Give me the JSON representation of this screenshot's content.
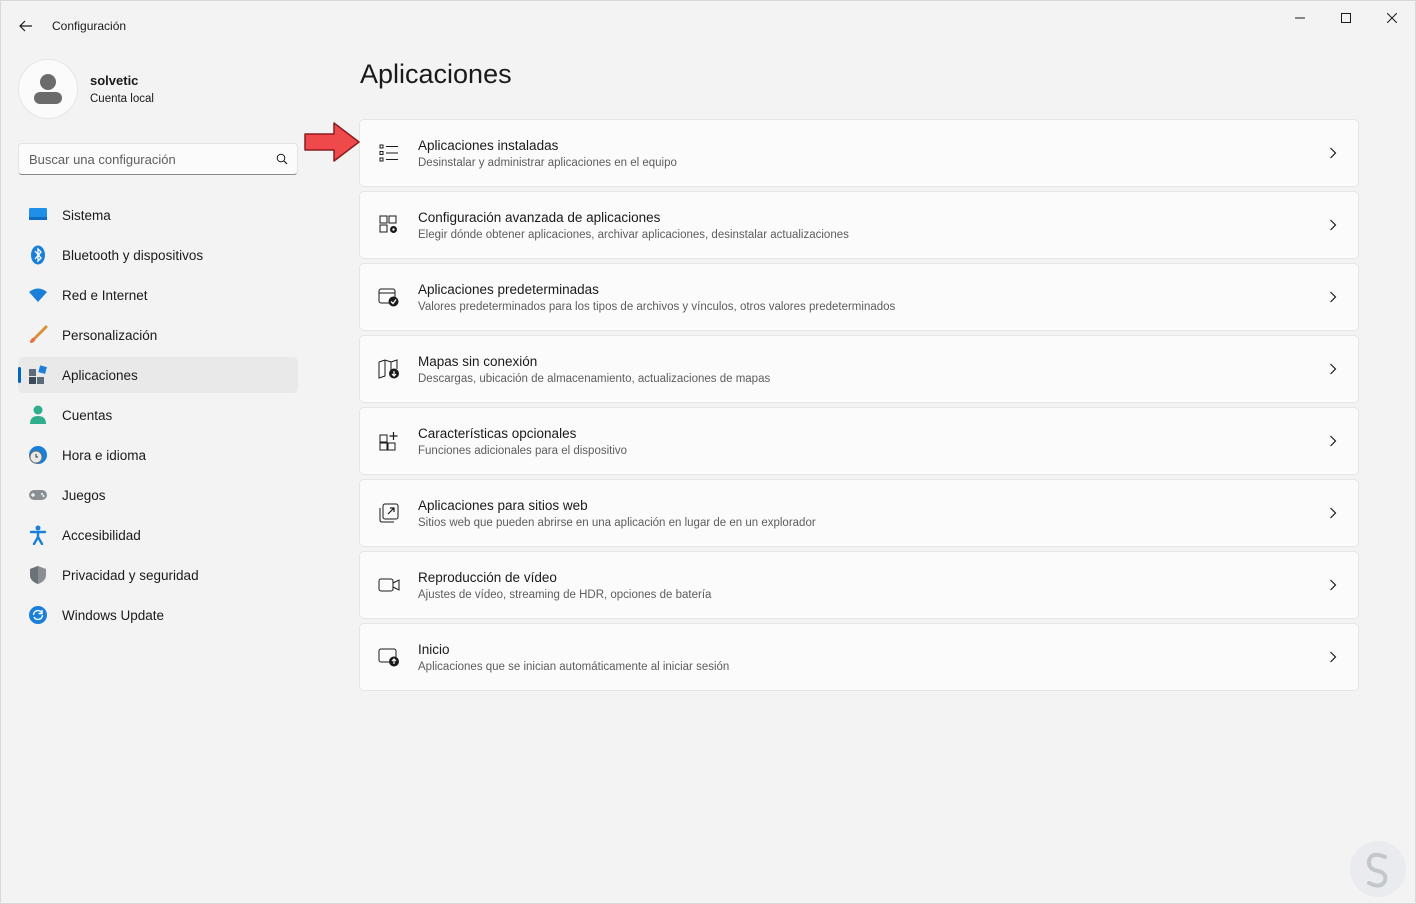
{
  "window": {
    "title": "Configuración",
    "controls": [
      "minimize-icon",
      "maximize-icon",
      "close-icon"
    ]
  },
  "profile": {
    "name": "solvetic",
    "account_type": "Cuenta local"
  },
  "search": {
    "placeholder": "Buscar una configuración"
  },
  "sidebar": {
    "items": [
      {
        "label": "Sistema",
        "icon": "monitor-icon"
      },
      {
        "label": "Bluetooth y dispositivos",
        "icon": "bluetooth-icon"
      },
      {
        "label": "Red e Internet",
        "icon": "wifi-icon"
      },
      {
        "label": "Personalización",
        "icon": "paintbrush-icon"
      },
      {
        "label": "Aplicaciones",
        "icon": "apps-icon",
        "active": true
      },
      {
        "label": "Cuentas",
        "icon": "person-icon"
      },
      {
        "label": "Hora e idioma",
        "icon": "globe-clock-icon"
      },
      {
        "label": "Juegos",
        "icon": "gamepad-icon"
      },
      {
        "label": "Accesibilidad",
        "icon": "accessibility-icon"
      },
      {
        "label": "Privacidad y seguridad",
        "icon": "shield-icon"
      },
      {
        "label": "Windows Update",
        "icon": "refresh-icon"
      }
    ]
  },
  "main": {
    "title": "Aplicaciones",
    "cards": [
      {
        "title": "Aplicaciones instaladas",
        "subtitle": "Desinstalar y administrar aplicaciones en el equipo",
        "icon": "list-icon"
      },
      {
        "title": "Configuración avanzada de aplicaciones",
        "subtitle": "Elegir dónde obtener aplicaciones, archivar aplicaciones, desinstalar actualizaciones",
        "icon": "app-gear-icon"
      },
      {
        "title": "Aplicaciones predeterminadas",
        "subtitle": "Valores predeterminados para los tipos de archivos y vínculos, otros valores predeterminados",
        "icon": "window-check-icon"
      },
      {
        "title": "Mapas sin conexión",
        "subtitle": "Descargas, ubicación de almacenamiento, actualizaciones de mapas",
        "icon": "map-download-icon"
      },
      {
        "title": "Características opcionales",
        "subtitle": "Funciones adicionales para el dispositivo",
        "icon": "grid-add-icon"
      },
      {
        "title": "Aplicaciones para sitios web",
        "subtitle": "Sitios web que pueden abrirse en una aplicación en lugar de en un explorador",
        "icon": "open-external-icon"
      },
      {
        "title": "Reproducción de vídeo",
        "subtitle": "Ajustes de vídeo, streaming de HDR, opciones de batería",
        "icon": "video-icon"
      },
      {
        "title": "Inicio",
        "subtitle": "Aplicaciones que se inician automáticamente al iniciar sesión",
        "icon": "startup-icon"
      }
    ]
  },
  "colors": {
    "accent": "#0067c0",
    "annotation_arrow": "#f0494b",
    "background": "#f3f3f3",
    "card": "#fbfbfb"
  }
}
